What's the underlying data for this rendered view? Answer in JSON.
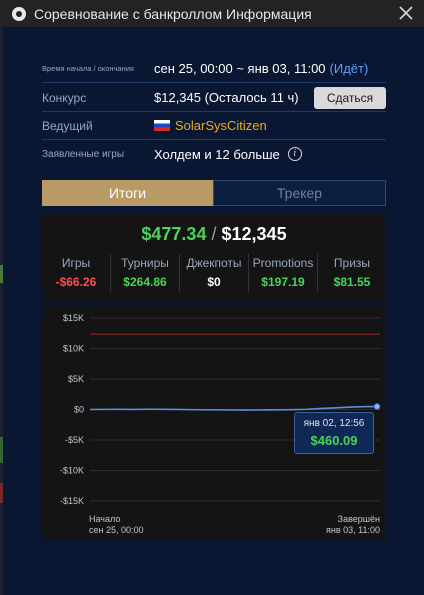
{
  "window": {
    "title": "Соревнование с банкроллом Информация"
  },
  "info": {
    "time_label": "Время начала / окончания",
    "time_value": "сен 25, 00:00 ~ янв 03, 11:00",
    "time_status": "(Идёт)",
    "contest_label": "Конкурс",
    "contest_value": "$12,345 (Осталось 11 ч)",
    "giveup_label": "Сдаться",
    "host_label": "Ведущий",
    "host_name": "SolarSysCitizen",
    "games_label": "Заявленные игры",
    "games_value": "Холдем и 12 больше"
  },
  "tabs": [
    {
      "label": "Итоги",
      "active": true
    },
    {
      "label": "Трекер",
      "active": false
    }
  ],
  "summary": {
    "profit": "$477.34",
    "separator": "/",
    "bankroll": "$12,345",
    "stats": [
      {
        "label": "Игры",
        "value": "-$66.26",
        "color": "#ff4d4d"
      },
      {
        "label": "Турниры",
        "value": "$264.86",
        "color": "#4ad45a"
      },
      {
        "label": "Джекпоты",
        "value": "$0",
        "color": "#ffffff"
      },
      {
        "label": "Promotions",
        "value": "$197.19",
        "color": "#4ad45a"
      },
      {
        "label": "Призы",
        "value": "$81.55",
        "color": "#4ad45a"
      }
    ]
  },
  "chart_data": {
    "type": "line",
    "y_ticks": [
      "$15K",
      "$10K",
      "$5K",
      "$0",
      "-$5K",
      "-$10K",
      "-$15K"
    ],
    "ylim": [
      -15000,
      15000
    ],
    "target_line": 12345,
    "series": [
      {
        "values": [
          0,
          20,
          30,
          15,
          40,
          25,
          10,
          -20,
          -40,
          -60,
          -80,
          -90,
          -70,
          -50,
          -30,
          20,
          150,
          250,
          380,
          460,
          477
        ]
      }
    ],
    "x_start_label": [
      "Начало",
      "сен 25, 00:00"
    ],
    "x_end_label": [
      "Завершён",
      "янв 03, 11:00"
    ],
    "tooltip": {
      "date": "янв 02, 12:56",
      "value": "$460.09"
    },
    "colors": {
      "line": "#5b8fe0",
      "target": "#8a2a2a",
      "grid": "#2e2e2e"
    }
  }
}
